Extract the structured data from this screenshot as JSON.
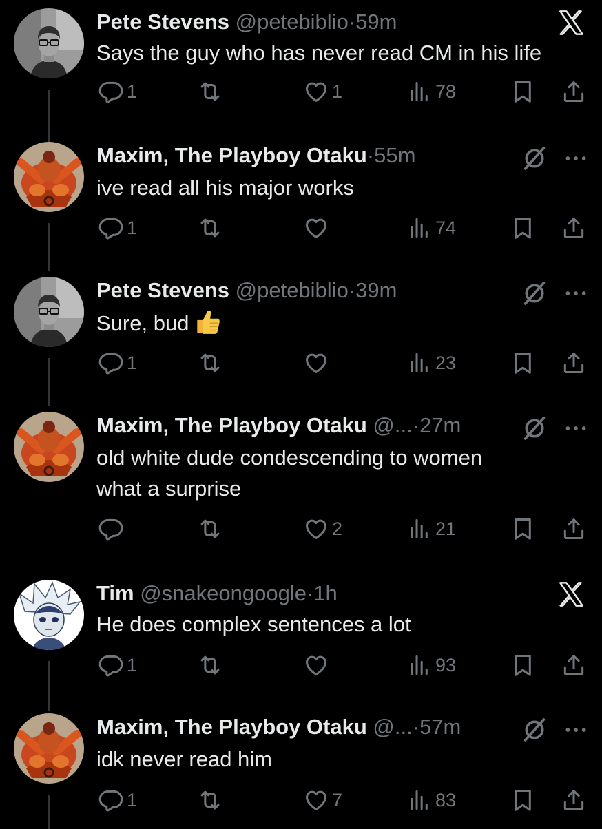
{
  "tweets": [
    {
      "name": "Pete Stevens",
      "handle": "@petebiblio",
      "dot": "·",
      "time": "59m",
      "text": "Says the guy who has never read CM in his life",
      "replies": "1",
      "retweets": "",
      "likes": "1",
      "views": "78",
      "top_icon": "x-logo-icon"
    },
    {
      "name": "Maxim, The Playboy Otaku",
      "handle": "",
      "dot": "·",
      "time": "55m",
      "text": "ive read all his major works",
      "replies": "1",
      "retweets": "",
      "likes": "",
      "views": "74",
      "top_icon": "muted-icon"
    },
    {
      "name": "Pete Stevens",
      "handle": "@petebiblio",
      "dot": "·",
      "time": "39m",
      "text": "Sure, bud",
      "emoji": "thumbs-up-emoji",
      "replies": "1",
      "retweets": "",
      "likes": "",
      "views": "23",
      "top_icon": "muted-icon"
    },
    {
      "name": "Maxim, The Playboy Otaku",
      "handle": "@...",
      "dot": "·",
      "time": "27m",
      "text_line1": "old white dude condescending to women",
      "text_line2": "what a surprise",
      "replies": "",
      "retweets": "",
      "likes": "2",
      "views": "21",
      "top_icon": "muted-icon"
    },
    {
      "name": "Tim",
      "handle": "@snakeongoogle",
      "dot": "·",
      "time": "1h",
      "text": "He does complex sentences a lot",
      "replies": "1",
      "retweets": "",
      "likes": "",
      "views": "93",
      "top_icon": "x-logo-icon"
    },
    {
      "name": "Maxim, The Playboy Otaku",
      "handle": "@...",
      "dot": "·",
      "time": "57m",
      "text": "idk never read him",
      "replies": "1",
      "retweets": "",
      "likes": "7",
      "views": "83",
      "top_icon": "muted-icon"
    }
  ],
  "colors": {
    "background": "#000000",
    "text": "#e7e9ea",
    "muted": "#71767b",
    "thread_line": "#333639"
  }
}
